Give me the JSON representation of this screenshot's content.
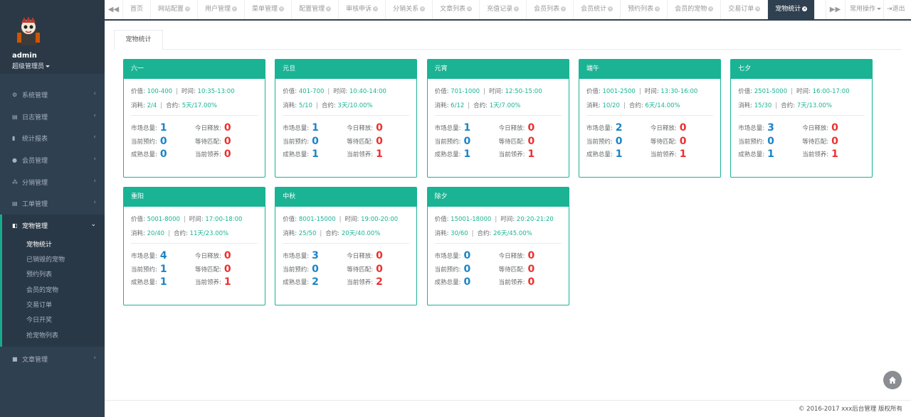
{
  "profile": {
    "name": "admin",
    "role": "超级管理员"
  },
  "sidebar": {
    "items": [
      {
        "label": "系统管理",
        "icon": "gear-icon",
        "glyph": "⚙"
      },
      {
        "label": "日志管理",
        "icon": "list-icon",
        "glyph": "▤"
      },
      {
        "label": "统计报表",
        "icon": "bar-chart-icon",
        "glyph": "▮"
      },
      {
        "label": "会员管理",
        "icon": "user-icon",
        "glyph": "●"
      },
      {
        "label": "分销管理",
        "icon": "users-icon",
        "glyph": "⁂"
      },
      {
        "label": "工单管理",
        "icon": "list-icon",
        "glyph": "▤"
      },
      {
        "label": "宠物管理",
        "icon": "book-icon",
        "glyph": "◧"
      },
      {
        "label": "文章管理",
        "icon": "square-icon",
        "glyph": "■"
      }
    ],
    "sub": [
      "宠物统计",
      "已销毁的宠物",
      "预约列表",
      "会员的宠物",
      "交易订单",
      "今日开奖",
      "抢宠物列表"
    ]
  },
  "tabs": [
    "首页",
    "网站配置",
    "用户管理",
    "菜单管理",
    "配置管理",
    "审核申诉",
    "分销关系",
    "文章列表",
    "充值记录",
    "会员列表",
    "会员统计",
    "预约列表",
    "会员的宠物",
    "交易订单",
    "宠物统计"
  ],
  "tabs_active_index": 14,
  "tab_menu": "常用操作",
  "tab_exit": "退出",
  "content_tab": "宠物统计",
  "labels": {
    "value": "价值:",
    "time": "时间:",
    "consume": "消耗:",
    "contract": "合约:",
    "market": "市场总量:",
    "release": "今日释放:",
    "booking": "当前预约:",
    "waiting": "等待匹配:",
    "mature": "成熟总量:",
    "adopt": "当前领养:"
  },
  "cards": [
    {
      "title": "六一",
      "value": "100-400",
      "time": "10:35-13:00",
      "consume": "2/4",
      "contract": "5天/17.00%",
      "market": "1",
      "release": "0",
      "booking": "0",
      "waiting": "0",
      "mature": "0",
      "adopt": "0"
    },
    {
      "title": "元旦",
      "value": "401-700",
      "time": "10:40-14:00",
      "consume": "5/10",
      "contract": "3天/10.00%",
      "market": "1",
      "release": "0",
      "booking": "0",
      "waiting": "0",
      "mature": "1",
      "adopt": "1"
    },
    {
      "title": "元宵",
      "value": "701-1000",
      "time": "12:50-15:00",
      "consume": "6/12",
      "contract": "1天/7.00%",
      "market": "1",
      "release": "0",
      "booking": "0",
      "waiting": "0",
      "mature": "1",
      "adopt": "1"
    },
    {
      "title": "端午",
      "value": "1001-2500",
      "time": "13:30-16:00",
      "consume": "10/20",
      "contract": "6天/14.00%",
      "market": "2",
      "release": "0",
      "booking": "0",
      "waiting": "0",
      "mature": "1",
      "adopt": "1"
    },
    {
      "title": "七夕",
      "value": "2501-5000",
      "time": "16:00-17:00",
      "consume": "15/30",
      "contract": "7天/13.00%",
      "market": "3",
      "release": "0",
      "booking": "0",
      "waiting": "0",
      "mature": "1",
      "adopt": "1"
    },
    {
      "title": "重阳",
      "value": "5001-8000",
      "time": "17:00-18:00",
      "consume": "20/40",
      "contract": "11天/23.00%",
      "market": "4",
      "release": "0",
      "booking": "1",
      "waiting": "0",
      "mature": "1",
      "adopt": "1"
    },
    {
      "title": "中秋",
      "value": "8001-15000",
      "time": "19:00-20:00",
      "consume": "25/50",
      "contract": "20天/40.00%",
      "market": "3",
      "release": "0",
      "booking": "0",
      "waiting": "0",
      "mature": "2",
      "adopt": "2"
    },
    {
      "title": "除夕",
      "value": "15001-18000",
      "time": "20:20-21:20",
      "consume": "30/60",
      "contract": "26天/45.00%",
      "market": "0",
      "release": "0",
      "booking": "0",
      "waiting": "0",
      "mature": "0",
      "adopt": "0"
    }
  ],
  "footer": "© 2016-2017 xxx后台管理 版权所有",
  "colors": {
    "accent": "#1ab394",
    "sidebar": "#2f4050",
    "blue_number": "#1c84c6",
    "red_number": "#ed2f2f"
  }
}
